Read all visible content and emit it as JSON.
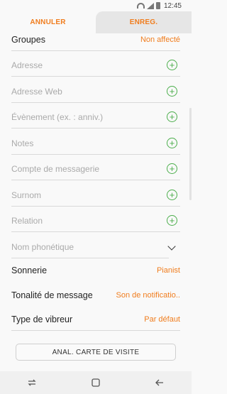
{
  "status_bar": {
    "time": "12:45"
  },
  "action_bar": {
    "cancel_label": "ANNULER",
    "save_label": "ENREG."
  },
  "groups": {
    "label": "Groupes",
    "value": "Non affecté"
  },
  "fields": [
    {
      "placeholder": "Adresse"
    },
    {
      "placeholder": "Adresse Web"
    },
    {
      "placeholder": "Évènement (ex. : anniv.)"
    },
    {
      "placeholder": "Notes"
    },
    {
      "placeholder": "Compte de messagerie"
    },
    {
      "placeholder": "Surnom"
    },
    {
      "placeholder": "Relation"
    },
    {
      "placeholder": "Nom phonétique"
    }
  ],
  "settings": [
    {
      "label": "Sonnerie",
      "value": "Pianist"
    },
    {
      "label": "Tonalité de message",
      "value": "Son de notificatio.."
    },
    {
      "label": "Type de vibreur",
      "value": "Par défaut"
    }
  ],
  "card_button": {
    "label": "ANAL. CARTE DE VISITE"
  },
  "colors": {
    "accent": "#f07d1e",
    "add_icon": "#4cae4c"
  },
  "icons": [
    "wifi-icon",
    "signal-icon",
    "battery-icon",
    "add-icon",
    "chevron-down-icon",
    "recent-apps-icon",
    "home-icon",
    "back-icon"
  ]
}
